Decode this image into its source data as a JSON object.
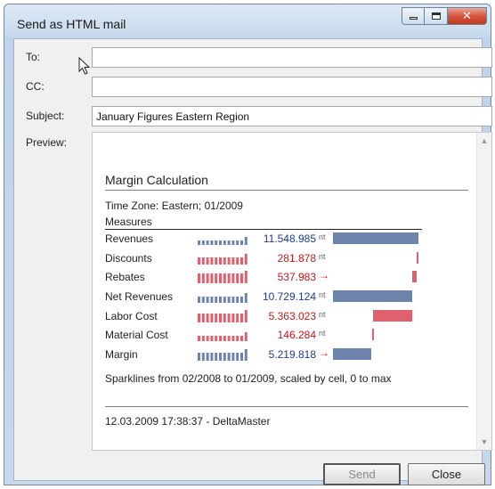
{
  "window": {
    "title": "Send as HTML mail"
  },
  "form": {
    "to_label": "To:",
    "to_value": "",
    "cc_label": "CC:",
    "cc_value": "",
    "subject_label": "Subject:",
    "subject_value": "January Figures Eastern Region",
    "preview_label": "Preview:"
  },
  "report": {
    "title": "Margin Calculation",
    "timezone": "Time Zone: Eastern; 01/2009",
    "measures_header": "Measures",
    "rows": [
      {
        "name": "Revenues",
        "value": "11.548.985",
        "indicator": "nt",
        "color": "blue",
        "share": 1.0,
        "offset": 0.0
      },
      {
        "name": "Discounts",
        "value": "281.878",
        "indicator": "nt",
        "color": "red",
        "share": 0.02,
        "offset": 0.98
      },
      {
        "name": "Rebates",
        "value": "537.983",
        "indicator": "→",
        "color": "red",
        "share": 0.05,
        "offset": 0.93
      },
      {
        "name": "Net Revenues",
        "value": "10.729.124",
        "indicator": "nt",
        "color": "blue",
        "share": 0.93,
        "offset": 0.0
      },
      {
        "name": "Labor Cost",
        "value": "5.363.023",
        "indicator": "nt",
        "color": "red",
        "share": 0.46,
        "offset": 0.47
      },
      {
        "name": "Material Cost",
        "value": "146.284",
        "indicator": "nt",
        "color": "red",
        "share": 0.013,
        "offset": 0.46
      },
      {
        "name": "Margin",
        "value": "5.219.818",
        "indicator": "→",
        "color": "blue",
        "share": 0.45,
        "offset": 0.0
      }
    ],
    "footnote": "Sparklines from 02/2008 to 01/2009, scaled by cell, 0 to max",
    "timestamp": "12.03.2009 17:38:37 - DeltaMaster"
  },
  "buttons": {
    "send": "Send",
    "close": "Close"
  },
  "colors": {
    "blue": "#6f84ad",
    "red": "#e0606e",
    "blue_text": "#1f3c8c",
    "red_text": "#c41818"
  },
  "icons": {
    "minimize": "minimize-icon",
    "maximize": "maximize-icon",
    "close": "close-icon",
    "cursor": "mouse-pointer-icon"
  }
}
